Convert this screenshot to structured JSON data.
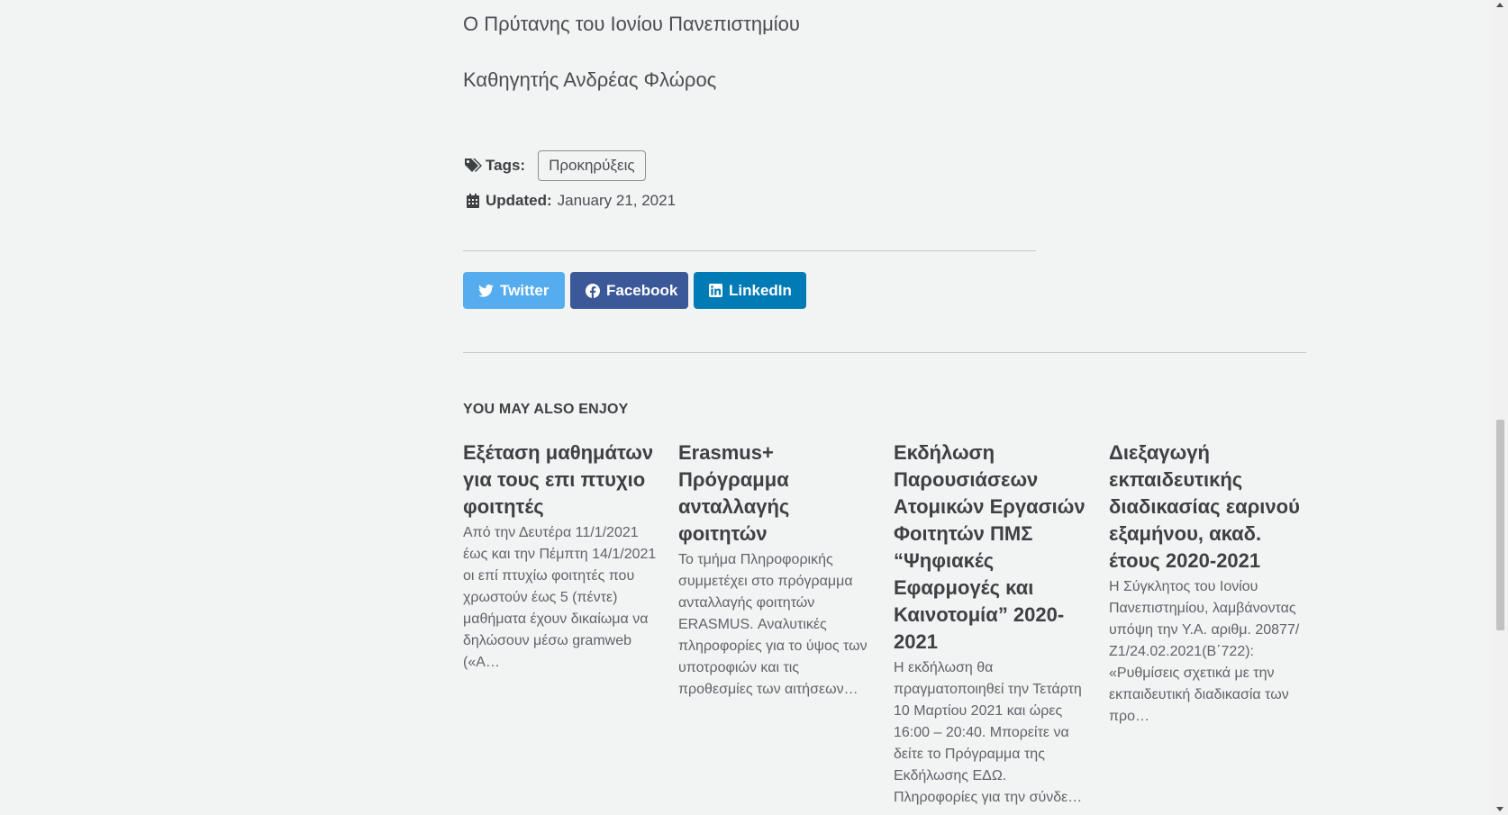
{
  "signature": {
    "line1": "Ο Πρύτανης του Ιονίου Πανεπιστημίου",
    "line2": "Καθηγητής Ανδρέας Φλώρος"
  },
  "meta": {
    "tags_label": "Tags:",
    "tag": "Προκηρύξεις",
    "updated_label": "Updated:",
    "updated_value": "January 21, 2021",
    "tags_icon": "tags-icon",
    "calendar_icon": "calendar-icon"
  },
  "share": {
    "twitter": {
      "label": "Twitter",
      "icon": "twitter-icon",
      "color": "#55acee"
    },
    "facebook": {
      "label": "Facebook",
      "icon": "facebook-icon",
      "color": "#3b5998"
    },
    "linkedin": {
      "label": "LinkedIn",
      "icon": "linkedin-icon",
      "color": "#007bb6"
    }
  },
  "related": {
    "title": "YOU MAY ALSO ENJOY",
    "items": [
      {
        "title": "Εξέταση μαθημάτων για τους επι πτυχιο φοιτητές",
        "excerpt": "Από την Δευτέρα 11/1/2021 έως και την Πέμπτη 14/1/2021 οι επί πτυχίω φοιτητές που χρωστούν έως 5 (πέντε) μαθήματα έχουν δικαίωμα να δηλώσουν μέσω gramweb («Α…"
      },
      {
        "title": "Erasmus+ Πρόγραμμα ανταλλαγής φοιτητών",
        "excerpt": "Το τμήμα Πληροφορικής συμμετέχει στο πρόγραμμα ανταλλαγής φοιτητών ERASMUS. Αναλυτικές πληροφορίες για το ύψος των υποτροφιών και τις προθεσμίες των αιτήσεων…"
      },
      {
        "title": "Εκδήλωση Παρουσιάσεων Ατομικών Εργασιών Φοιτητών ΠΜΣ “Ψηφιακές Εφαρμογές και Καινοτομία” 2020-2021",
        "excerpt": "Η εκδήλωση θα πραγματοποιηθεί την Τετάρτη 10 Μαρτίου 2021 και ώρες 16:00 – 20:40. Μπορείτε να δείτε το Πρόγραμμα της Εκδήλωσης ΕΔΩ. Πληροφορίες για την σύνδε…"
      },
      {
        "title": "Διεξαγωγή εκπαιδευτικής διαδικασίας εαρινού εξαμήνου, ακαδ. έτους 2020-2021",
        "excerpt": "Η Σύγκλητος του Ιονίου Πανεπιστημίου, λαμβάνοντας υπόψη την Υ.Α. αριθμ. 20877/Ζ1/24.02.2021(Β΄722): «Ρυθμίσεις σχετικά με την εκπαιδευτική διαδικασία των προ…"
      }
    ]
  }
}
